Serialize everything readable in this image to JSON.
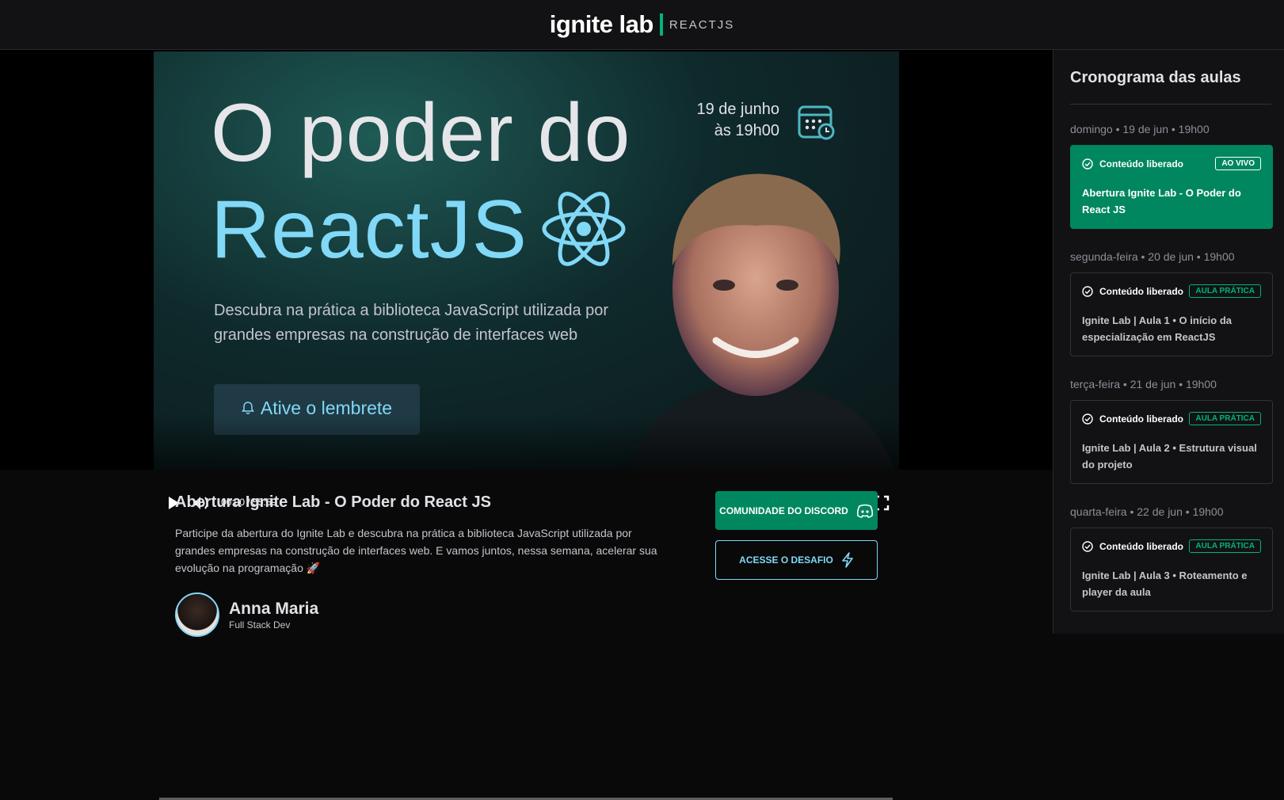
{
  "header": {
    "logo_main": "ignite lab",
    "logo_sub": "REACTJS"
  },
  "video": {
    "title_line1": "O poder do",
    "title_line2": "ReactJS",
    "description": "Descubra na prática a biblioteca JavaScript utilizada por grandes empresas na construção de interfaces web",
    "date_line1": "19 de junho",
    "date_line2": "às 19h00",
    "reminder_button": "Ative o lembrete",
    "time": "00:00 / 55:59",
    "progress": 0
  },
  "lesson": {
    "title": "Abertura Ignite Lab - O Poder do React JS",
    "description": "Participe da abertura do Ignite Lab e descubra na prática a biblioteca JavaScript utilizada por grandes empresas na construção de interfaces web. E vamos juntos, nessa semana, acelerar sua evolução na programação 🚀",
    "author_name": "Anna Maria",
    "author_role": "Full Stack Dev",
    "discord_button": "COMUNIDADE DO DISCORD",
    "challenge_button": "ACESSE O DESAFIO"
  },
  "sidebar": {
    "title": "Cronograma das aulas",
    "lessons": [
      {
        "date": "domingo • 19 de jun • 19h00",
        "status": "Conteúdo liberado",
        "badge": "AO VIVO",
        "title": "Abertura Ignite Lab - O Poder do React JS",
        "active": true
      },
      {
        "date": "segunda-feira • 20 de jun • 19h00",
        "status": "Conteúdo liberado",
        "badge": "AULA PRÁTICA",
        "title": "Ignite Lab | Aula 1 • O início da especialização em ReactJS",
        "active": false
      },
      {
        "date": "terça-feira • 21 de jun • 19h00",
        "status": "Conteúdo liberado",
        "badge": "AULA PRÁTICA",
        "title": "Ignite Lab | Aula 2 • Estrutura visual do projeto",
        "active": false
      },
      {
        "date": "quarta-feira • 22 de jun • 19h00",
        "status": "Conteúdo liberado",
        "badge": "AULA PRÁTICA",
        "title": "Ignite Lab | Aula 3 • Roteamento e player da aula",
        "active": false
      }
    ]
  },
  "colors": {
    "accent": "#00875f",
    "brand_green": "#00b37e",
    "react_blue": "#81d8f7"
  }
}
